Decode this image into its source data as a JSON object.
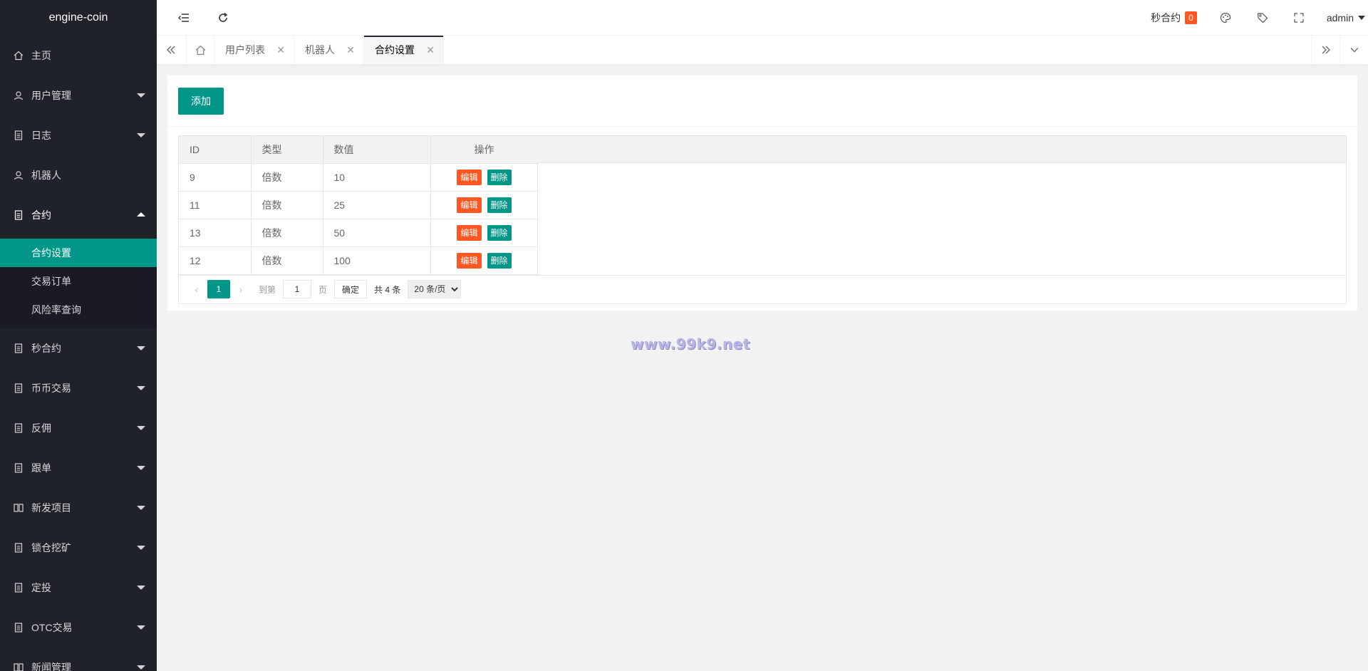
{
  "app": {
    "logo": "engine-coin"
  },
  "sidebar": {
    "items": [
      {
        "label": "主页",
        "icon": "home-icon"
      },
      {
        "label": "用户管理",
        "icon": "user-icon"
      },
      {
        "label": "日志",
        "icon": "doc-icon"
      },
      {
        "label": "机器人",
        "icon": "user-icon"
      },
      {
        "label": "合约",
        "icon": "doc-icon"
      },
      {
        "label": "秒合约",
        "icon": "doc-icon"
      },
      {
        "label": "币币交易",
        "icon": "doc-icon"
      },
      {
        "label": "反佣",
        "icon": "doc-icon"
      },
      {
        "label": "跟单",
        "icon": "doc-icon"
      },
      {
        "label": "新发项目",
        "icon": "book-icon"
      },
      {
        "label": "锁仓挖矿",
        "icon": "doc-icon"
      },
      {
        "label": "定投",
        "icon": "doc-icon"
      },
      {
        "label": "OTC交易",
        "icon": "doc-icon"
      },
      {
        "label": "新闻管理",
        "icon": "book-icon"
      }
    ],
    "sub_items": [
      {
        "label": "合约设置"
      },
      {
        "label": "交易订单"
      },
      {
        "label": "风险率查询"
      }
    ]
  },
  "header": {
    "second_contract_label": "秒合约",
    "second_contract_count": "0",
    "user": "admin"
  },
  "tabs": [
    {
      "label": "用户列表"
    },
    {
      "label": "机器人"
    },
    {
      "label": "合约设置"
    }
  ],
  "main": {
    "add_button": "添加",
    "columns": [
      "ID",
      "类型",
      "数值",
      "操作"
    ],
    "rows": [
      {
        "id": "9",
        "type": "倍数",
        "value": "10"
      },
      {
        "id": "11",
        "type": "倍数",
        "value": "25"
      },
      {
        "id": "13",
        "type": "倍数",
        "value": "50"
      },
      {
        "id": "12",
        "type": "倍数",
        "value": "100"
      }
    ],
    "edit_label": "编辑",
    "delete_label": "删除",
    "pager": {
      "current": "1",
      "goto_label": "到第",
      "goto_value": "1",
      "page_label": "页",
      "confirm": "确定",
      "total": "共 4 条",
      "page_size": "20 条/页"
    }
  },
  "watermark": "www.99k9.net",
  "colors": {
    "accent": "#009688",
    "danger": "#ff5722",
    "sidebar": "#20222a"
  }
}
